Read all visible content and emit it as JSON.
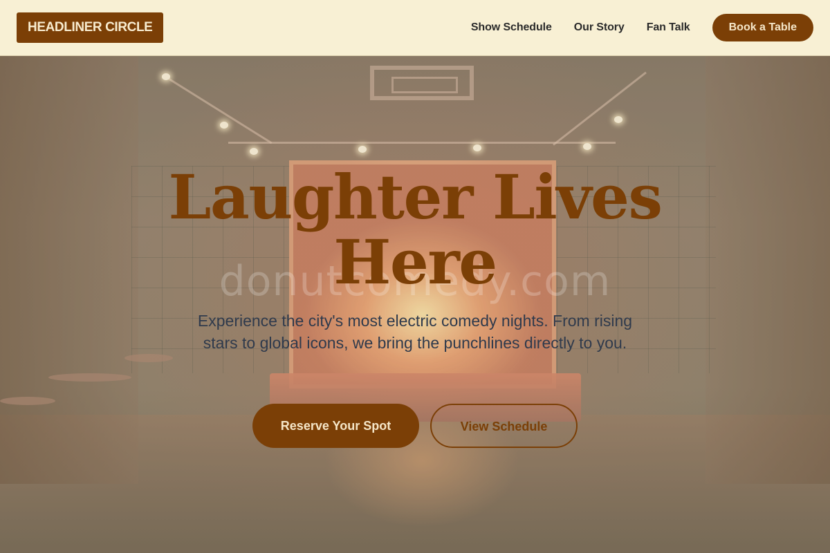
{
  "header": {
    "logo": "HEADLINER CIRCLE",
    "nav": [
      "Show Schedule",
      "Our Story",
      "Fan Talk"
    ],
    "cta": "Book a Table"
  },
  "hero": {
    "watermark": "donutcomedy.com",
    "headline": "Laughter Lives Here",
    "tagline": "Experience the city's most electric comedy nights. From rising stars to global icons, we bring the punchlines directly to you.",
    "primary_button": "Reserve Your Spot",
    "secondary_button": "View Schedule",
    "background_image": "comedy-club-stage-photo"
  },
  "colors": {
    "brand": "#7b3f06",
    "header_bg": "#f8f0d4",
    "tagline": "#2f3a4c"
  }
}
